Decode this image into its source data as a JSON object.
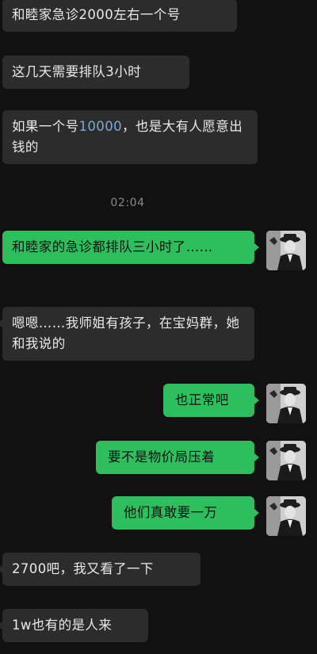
{
  "messages": [
    {
      "side": "in",
      "text": "和睦家急诊2000左右一个号"
    },
    {
      "side": "in",
      "text": "这几天需要排队3小时"
    },
    {
      "side": "in",
      "text_before": "如果一个号",
      "link": "10000",
      "text_after": "，也是大有人愿意出钱的"
    },
    {
      "side": "out",
      "text": "和睦家的急诊都排队三小时了……"
    },
    {
      "side": "in",
      "text": "嗯嗯……我师姐有孩子，在宝妈群，她和我说的"
    },
    {
      "side": "out",
      "text": "也正常吧"
    },
    {
      "side": "out",
      "text": "要不是物价局压着"
    },
    {
      "side": "out",
      "text": "他们真敢要一万"
    },
    {
      "side": "in",
      "text": "2700吧，我又看了一下"
    },
    {
      "side": "in",
      "text": "1w也有的是人来"
    }
  ],
  "timestamp": "02:04",
  "colors": {
    "background": "#111111",
    "incoming_bubble": "#2c2c2c",
    "outgoing_bubble": "#2fbe5d",
    "link": "#7ea8d6",
    "timestamp": "#8a8a8a"
  },
  "icons": {
    "avatar": "user-avatar-icon"
  }
}
